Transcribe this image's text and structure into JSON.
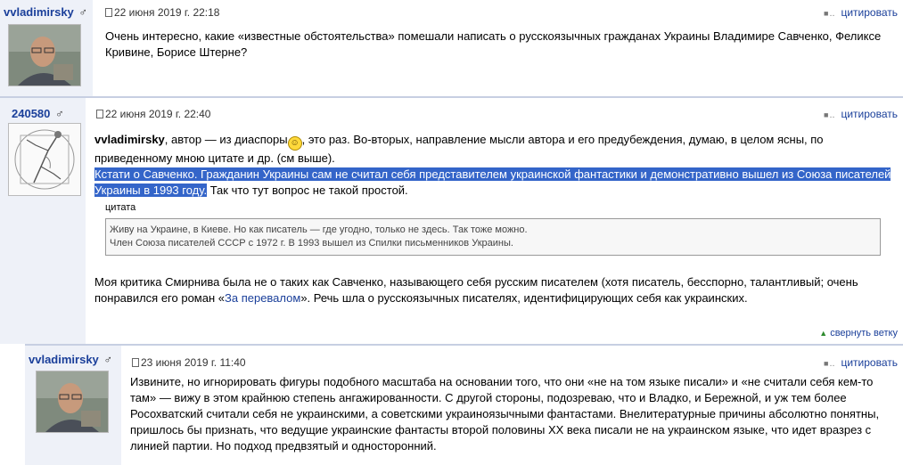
{
  "posts": [
    {
      "author": "vvladimirsky",
      "gender": "♂",
      "date": "22 июня 2019 г. 22:18",
      "quote_action": "цитировать",
      "text": "Очень интересно, какие «известные обстоятельства» помешали написать о русскоязычных гражданах Украины Владимире Савченко, Феликсе Кривине, Борисе Штерне?"
    },
    {
      "author": "240580",
      "gender": "♂",
      "date": "22 июня 2019 г. 22:40",
      "quote_action": "цитировать",
      "reply_to": "vvladimirsky",
      "line1_a": ", автор — из диаспоры",
      "line1_b": ", это раз. Во-вторых, направление мысли автора и его предубеждения, думаю, в целом ясны, по приведенному мною цитате и др. (см выше).",
      "highlighted": "Кстати о Савченко. Гражданин Украины сам не считал себя представителем украинской фантастики и демонстративно вышел из Союза писателей Украины в 1993 году.",
      "after_highlight": " Так что тут вопрос не такой простой.",
      "quote_title": "цитата",
      "quote_line1": "Живу на Украине, в Киеве. Но как писатель — где угодно, только не здесь. Так тоже можно.",
      "quote_line2": "Член Союза писателей СССР с 1972 г. В 1993 вышел из Спилки письменников Украины.",
      "para2_a": "Моя критика Смирнива была не о таких как Савченко, называющего себя русским писателем (хотя писатель, бесспорно, талантливый; очень понравился его роман «",
      "para2_link": "За перевалом",
      "para2_b": "». Речь шла о русскоязычных писателях, идентифицирующих себя как украинских.",
      "collapse": "свернуть ветку"
    },
    {
      "author": "vvladimirsky",
      "gender": "♂",
      "date": "23 июня 2019 г. 11:40",
      "quote_action": "цитировать",
      "text": "Извините, но игнорировать фигуры подобного масштаба на основании того, что они «не на том языке писали» и «не считали себя кем-то там» — вижу в этом крайнюю степень ангажированности. С другой стороны, подозреваю, что и Владко, и Бережной, и уж тем более Росохватский считали себя не украинскими, а советскими украиноязычными фантастами. Внелитературные причины абсолютно понятны, пришлось бы признать, что ведущие украинские фантасты второй половины XX века писали не на украинском языке, что идет вразрез с линией партии. Но подход предвзятый и односторонний."
    }
  ],
  "colors": {
    "author_bg": "#eef1f8",
    "link": "#1a3f9a",
    "highlight": "#3465c9"
  }
}
